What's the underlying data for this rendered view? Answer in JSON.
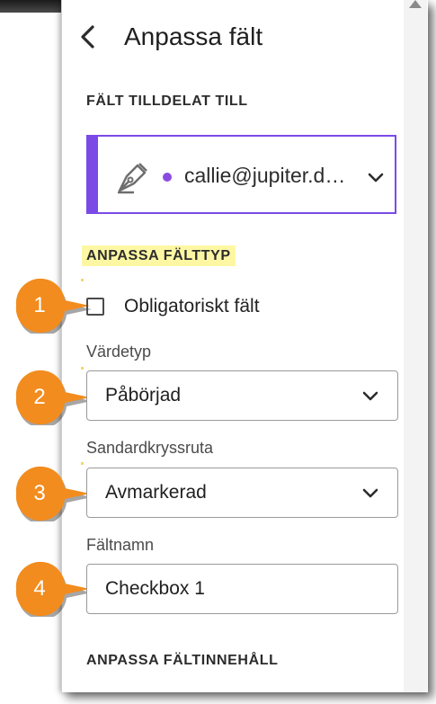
{
  "header": {
    "title": "Anpassa fält"
  },
  "assignment": {
    "section_label": "FÄLT TILLDELAT TILL",
    "assignee": "callie@jupiter.d…",
    "assignee_color": "#7b4ae6"
  },
  "customize_type": {
    "section_label": "ANPASSA FÄLTTYP",
    "required_checkbox": {
      "label": "Obligatoriskt fält",
      "checked": false
    },
    "value_type": {
      "label": "Värdetyp",
      "selected": "Påbörjad"
    },
    "default_checkbox": {
      "label": "Sandardkryssruta",
      "selected": "Avmarkerad"
    },
    "field_name": {
      "label": "Fältnamn",
      "value": "Checkbox 1"
    }
  },
  "customize_content": {
    "section_label": "ANPASSA FÄLTINNEHÅLL"
  },
  "callouts": [
    "1",
    "2",
    "3",
    "4"
  ],
  "colors": {
    "callout": "#f28c1e",
    "highlight": "#fdf7a3",
    "accent": "#7b4ae6"
  }
}
